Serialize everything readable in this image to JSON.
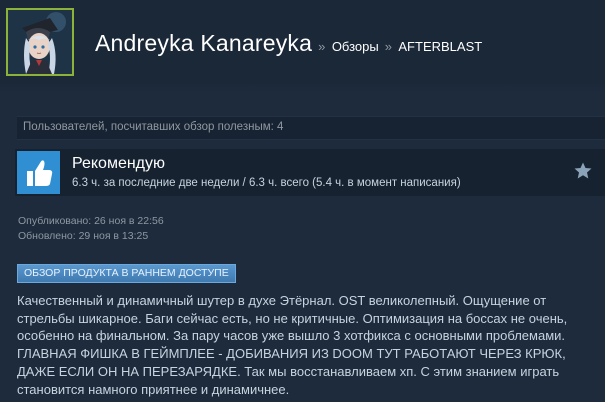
{
  "header": {
    "profile_name": "Andreyka Kanareyka",
    "crumb_sep_1": "»",
    "crumb_1": "Обзоры",
    "crumb_sep_2": "»",
    "crumb_2": "AFTERBLAST"
  },
  "review": {
    "helpful_text": "Пользователей, посчитавших обзор полезным: 4",
    "recommendation": "Рекомендую",
    "hours_text": "6.3 ч. за последние две недели / 6.3 ч. всего (5.4 ч. в момент написания)",
    "thumb_icon": "thumbs-up-icon",
    "star_icon": "star-icon",
    "posted": "Опубликовано: 26 ноя в 22:56",
    "updated": "Обновлено: 29 ноя в 13:25",
    "early_access_badge": "ОБЗОР ПРОДУКТА В РАННЕМ ДОСТУПЕ",
    "text_lines": [
      "Качественный и динамичный шутер в духе Этёрнал. OST великолепный. Ощущение от",
      "стрельбы шикарное. Баги сейчас есть, но не критичные. Оптимизация на боссах не очень,",
      "особенно на финальном. За пару часов уже вышло 3 хотфикса с основными проблемами.",
      "ГЛАВНАЯ ФИШКА В ГЕЙМПЛЕЕ - ДОБИВАНИЯ ИЗ DOOM ТУТ РАБОТАЮТ ЧЕРЕЗ КРЮК,",
      "ДАЖЕ ЕСЛИ ОН НА ПЕРЕЗАРЯДКЕ. Так мы восстанавливаем хп. С этим знанием играть",
      "становится намного приятнее и динамичнее."
    ]
  },
  "colors": {
    "background": "#1b2838",
    "content_background": "#1d2b3d",
    "accent_blue": "#2f8fd2",
    "avatar_border": "#8db23a",
    "badge": "#4d8bc1"
  }
}
